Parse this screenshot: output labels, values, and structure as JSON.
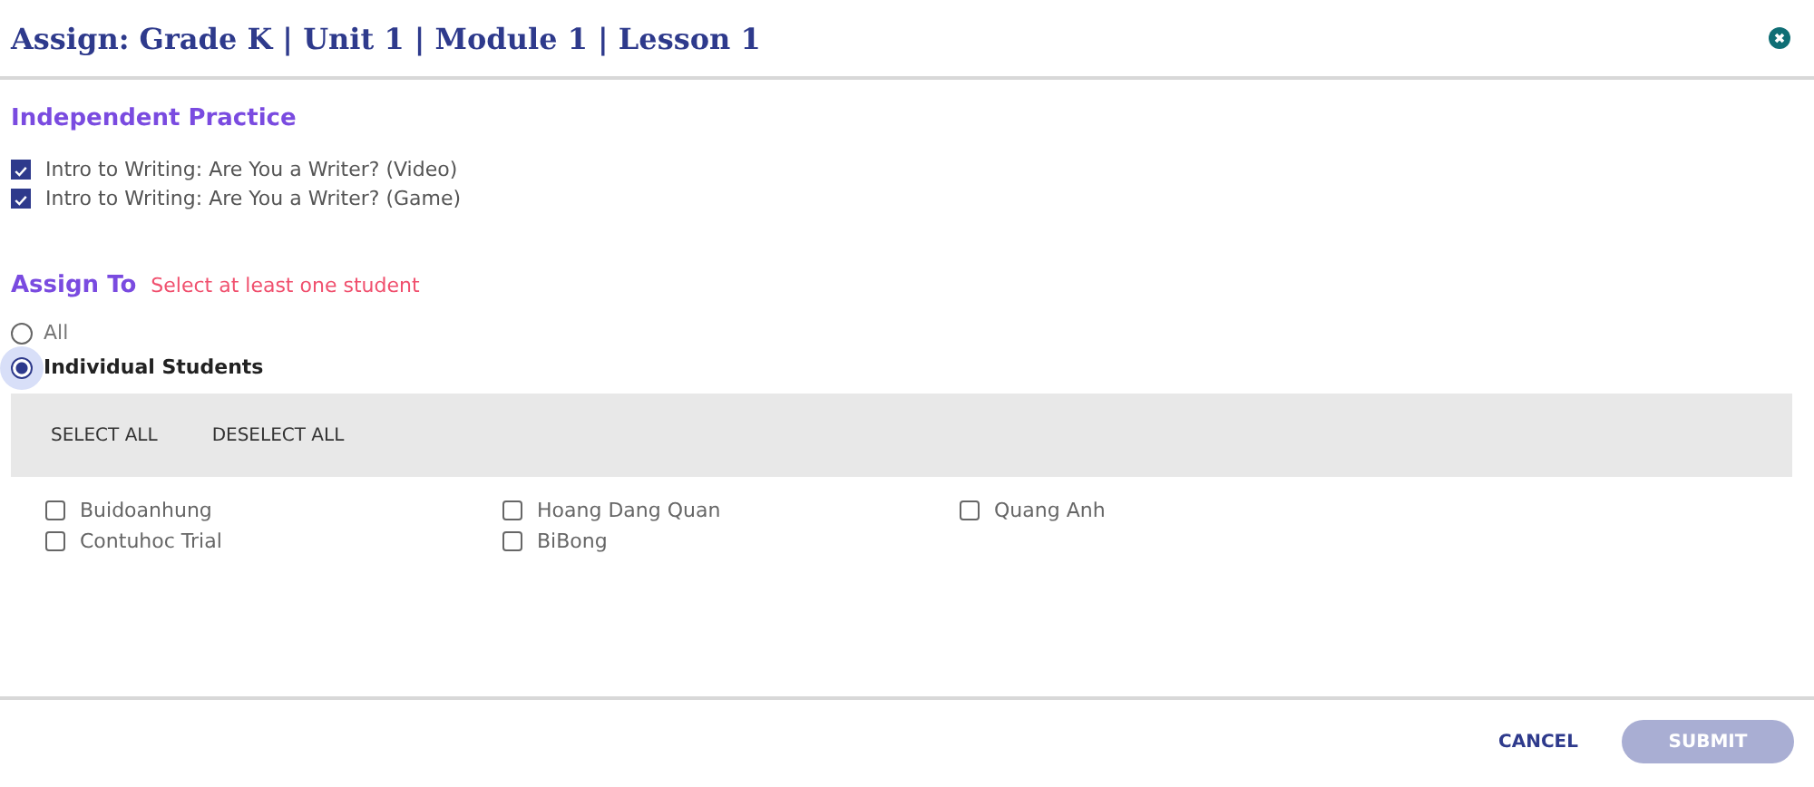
{
  "dialog": {
    "title": "Assign: Grade K | Unit 1 | Module 1 | Lesson 1"
  },
  "practice": {
    "heading": "Independent Practice",
    "items": [
      {
        "label": "Intro to Writing: Are You a Writer? (Video)",
        "checked": true
      },
      {
        "label": "Intro to Writing: Are You a Writer? (Game)",
        "checked": true
      }
    ]
  },
  "assign": {
    "heading": "Assign To",
    "error": "Select at least one student",
    "options": [
      {
        "label": "All",
        "selected": false
      },
      {
        "label": "Individual Students",
        "selected": true
      }
    ]
  },
  "toolbar": [
    "SELECT ALL",
    "DESELECT ALL"
  ],
  "students": [
    {
      "name": "Buidoanhung",
      "checked": false
    },
    {
      "name": "Contuhoc Trial",
      "checked": false
    },
    {
      "name": "Hoang Dang Quan",
      "checked": false
    },
    {
      "name": "BiBong",
      "checked": false
    },
    {
      "name": "Quang Anh",
      "checked": false
    }
  ],
  "footer": {
    "cancel": "CANCEL",
    "submit": {
      "label": "SUBMIT",
      "disabled": true
    }
  }
}
